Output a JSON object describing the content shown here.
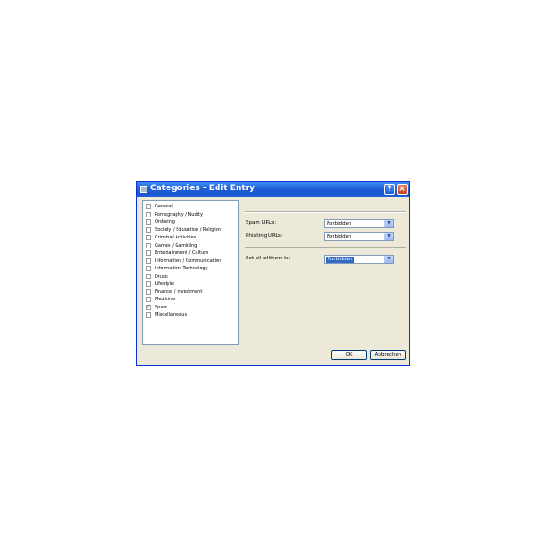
{
  "window": {
    "title": "Categories - Edit Entry",
    "help_label": "?",
    "close_label": "×"
  },
  "categories": [
    {
      "label": "General",
      "checked": false
    },
    {
      "label": "Pornography / Nudity",
      "checked": false
    },
    {
      "label": "Ordering",
      "checked": false
    },
    {
      "label": "Society / Education / Religion",
      "checked": false
    },
    {
      "label": "Criminal Activities",
      "checked": false
    },
    {
      "label": "Games / Gambling",
      "checked": false
    },
    {
      "label": "Entertainment / Culture",
      "checked": false
    },
    {
      "label": "Information / Communication",
      "checked": false
    },
    {
      "label": "Information Technology",
      "checked": false
    },
    {
      "label": "Drugs",
      "checked": false
    },
    {
      "label": "Lifestyle",
      "checked": false
    },
    {
      "label": "Finance / Investment",
      "checked": false
    },
    {
      "label": "Medicine",
      "checked": false
    },
    {
      "label": "Spam",
      "checked": true
    },
    {
      "label": "Miscellaneous",
      "checked": false
    }
  ],
  "settings": {
    "spam_urls_label": "Spam URLs:",
    "spam_urls_value": "Forbidden",
    "phishing_urls_label": "Phishing URLs:",
    "phishing_urls_value": "Forbidden",
    "set_all_label": "Set all of them to:",
    "set_all_value": "Forbidden"
  },
  "buttons": {
    "ok": "OK",
    "cancel": "Abbrechen"
  },
  "colors": {
    "titlebar": "#1f5fd6",
    "dialog_bg": "#ece9d8",
    "selection": "#316ac5"
  }
}
